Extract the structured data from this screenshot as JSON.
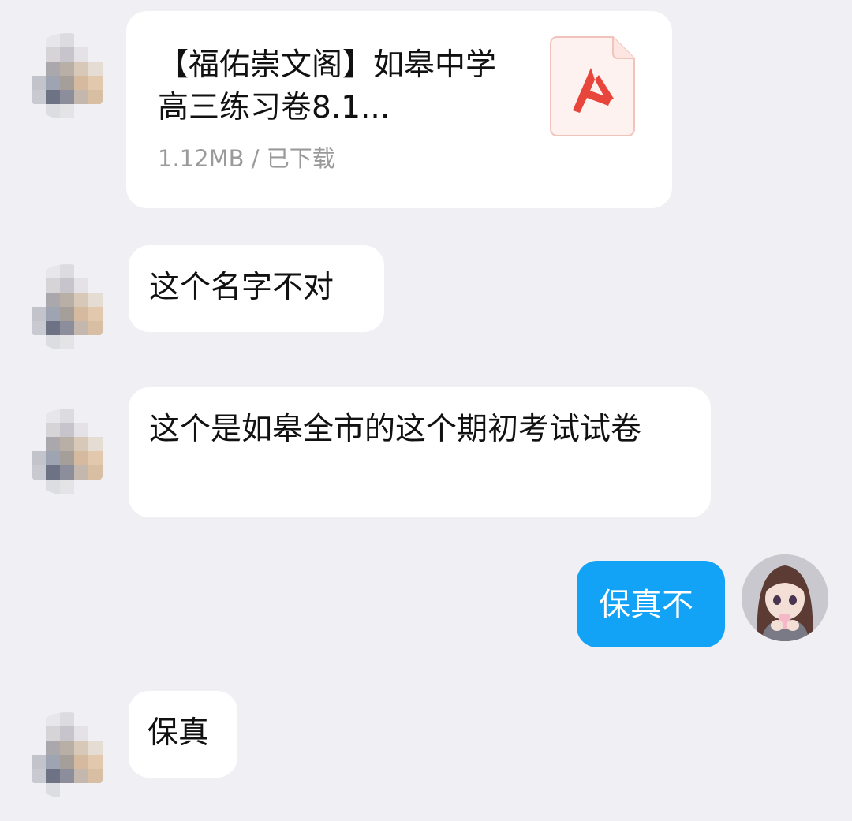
{
  "chat": {
    "file_message": {
      "title": "【福佑崇文阁】如皋中学高三练习卷8.1...",
      "meta": "1.12MB / 已下载",
      "icon": "pdf-icon",
      "accent": "#e8453c"
    },
    "messages": [
      {
        "side": "left",
        "text": "这个名字不对"
      },
      {
        "side": "left",
        "text": "这个是如皋全市的这个期初考试试卷"
      },
      {
        "side": "right",
        "text": "保真不"
      },
      {
        "side": "left",
        "text": "保真"
      }
    ],
    "colors": {
      "background": "#efeff4",
      "incoming_bubble": "#ffffff",
      "outgoing_bubble": "#12a2f6"
    }
  }
}
